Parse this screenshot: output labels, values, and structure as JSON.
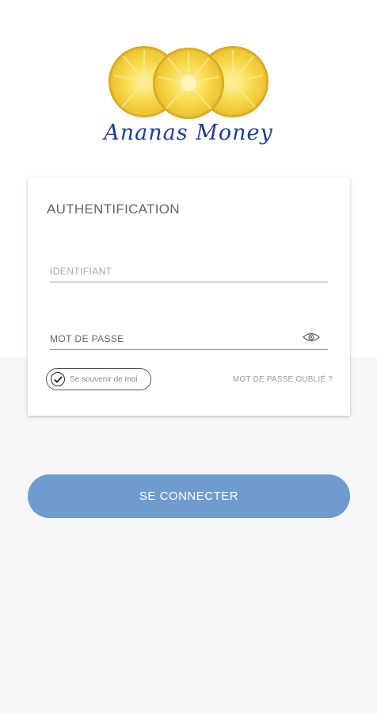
{
  "brand": {
    "name": "Ananas Money"
  },
  "auth": {
    "title": "AUTHENTIFICATION",
    "identifiant_placeholder": "IDENTIFIANT",
    "password_placeholder": "MOT DE PASSE",
    "remember_label": "Se souvenir de moi",
    "remember_checked": true,
    "forgot_link": "MOT DE PASSE OUBLIÉ ?"
  },
  "actions": {
    "connect_label": "SE CONNECTER"
  },
  "colors": {
    "button": "#6f9ccf",
    "brand_text": "#1f3c8f",
    "pineapple": "#f6d64a"
  },
  "icons": [
    "pineapple-logo",
    "eye-icon",
    "check-icon"
  ]
}
